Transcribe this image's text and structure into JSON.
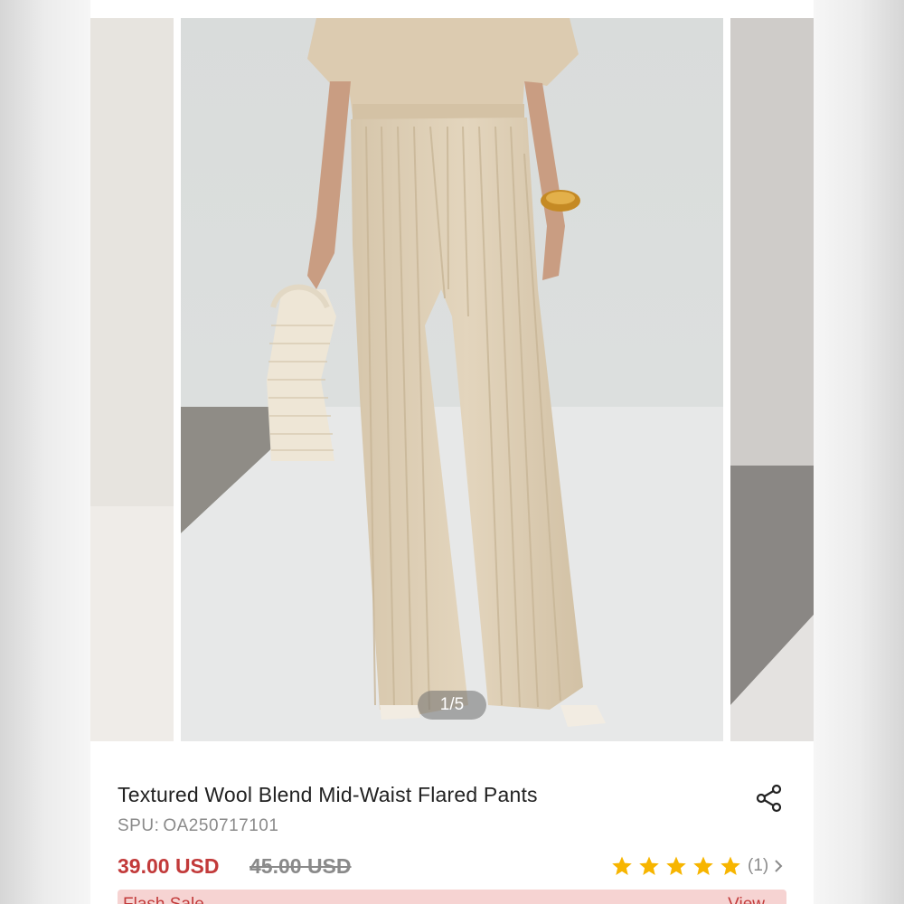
{
  "gallery": {
    "pager": "1/5",
    "image_alt": "Model wearing beige ribbed flared knit pants with matching top, holding woven bag"
  },
  "product": {
    "title": "Textured Wool Blend Mid-Waist Flared Pants",
    "spu_label": "SPU:",
    "spu": "OA250717101",
    "price": "39.00 USD",
    "old_price": "45.00 USD",
    "rating_stars": 5,
    "review_count": "(1)"
  },
  "flash_sale": {
    "label": "Flash Sale",
    "view": "View"
  },
  "icons": {
    "share": "share-icon",
    "star": "star-icon",
    "chevron": "chevron-right-icon"
  },
  "colors": {
    "price": "#c23a3a",
    "star": "#f7b500",
    "flash_bg": "#f6d3d2"
  }
}
